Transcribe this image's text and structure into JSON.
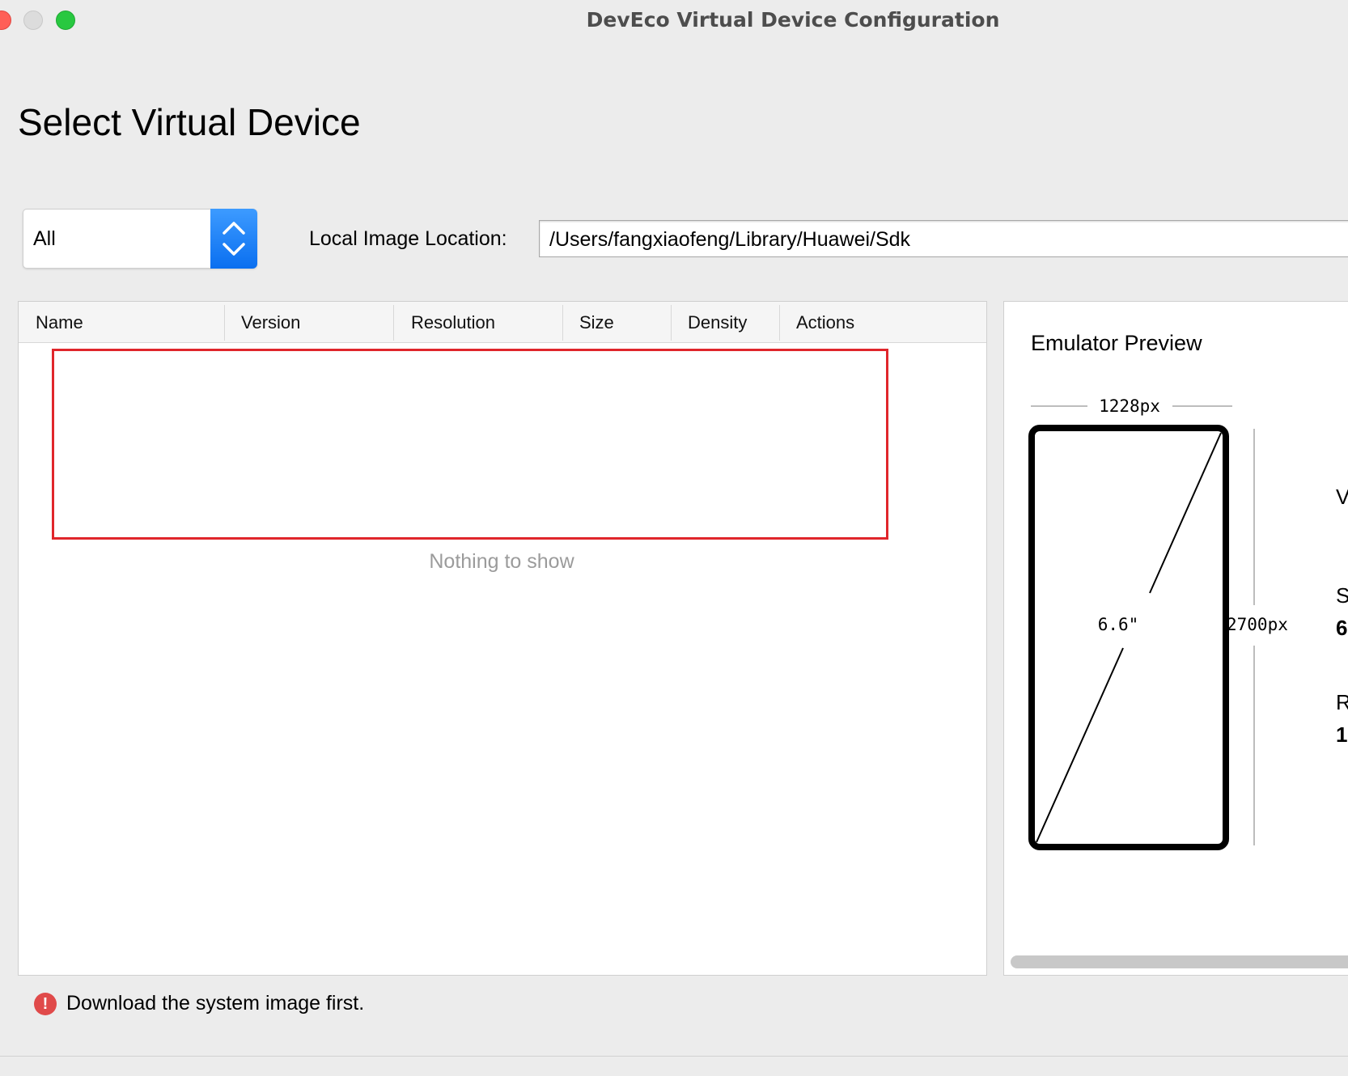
{
  "window": {
    "title": "DevEco Virtual Device Configuration"
  },
  "page": {
    "title": "Select Virtual Device"
  },
  "filter": {
    "selected": "All"
  },
  "location": {
    "label": "Local Image Location:",
    "value": "/Users/fangxiaofeng/Library/Huawei/Sdk"
  },
  "table": {
    "columns": [
      "Name",
      "Version",
      "Resolution",
      "Size",
      "Density",
      "Actions"
    ],
    "empty_text": "Nothing to show"
  },
  "preview": {
    "title": "Emulator Preview",
    "width_label": "1228px",
    "height_label": "2700px",
    "diagonal_label": "6.6\"",
    "side_letters": [
      "V",
      "S",
      "6",
      "R",
      "1"
    ]
  },
  "status": {
    "message": "Download the system image first.",
    "icon": "error-icon"
  },
  "colors": {
    "accent": "#0a6ff0",
    "error": "#e04a4a",
    "highlight": "#e0262b"
  }
}
